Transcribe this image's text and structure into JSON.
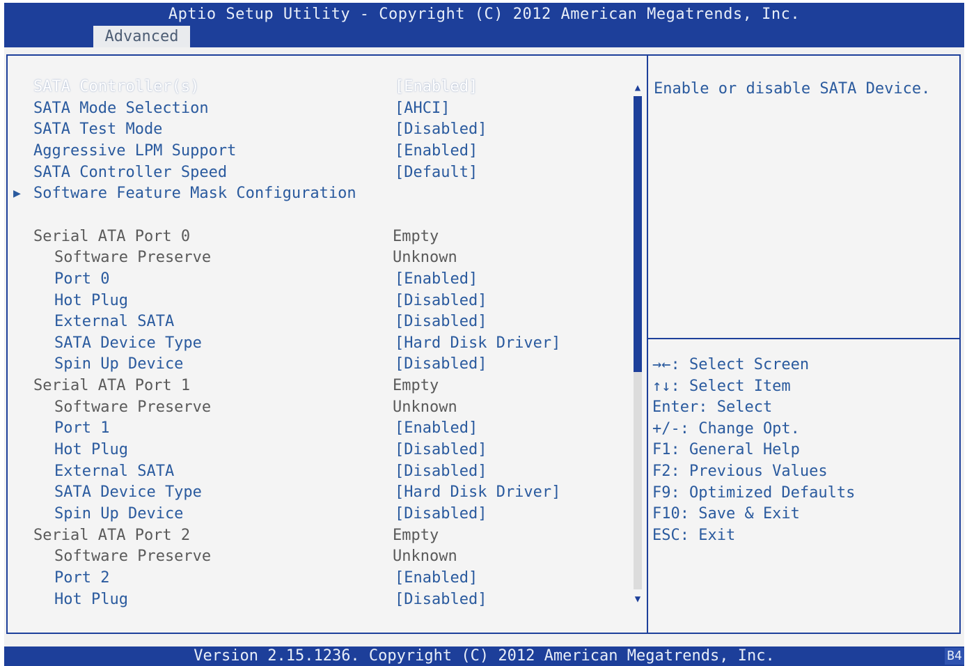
{
  "header": {
    "title": "Aptio Setup Utility - Copyright (C) 2012 American Megatrends, Inc.",
    "tab_label": "Advanced"
  },
  "settings": [
    {
      "label": "SATA Controller(s)",
      "value": "[Enabled]",
      "indent": 0,
      "style": "selected",
      "submenu": false
    },
    {
      "label": "SATA Mode Selection",
      "value": "[AHCI]",
      "indent": 0,
      "style": "blue",
      "submenu": false
    },
    {
      "label": "SATA Test Mode",
      "value": "[Disabled]",
      "indent": 0,
      "style": "blue",
      "submenu": false
    },
    {
      "label": "Aggressive LPM Support",
      "value": "[Enabled]",
      "indent": 0,
      "style": "blue",
      "submenu": false
    },
    {
      "label": "SATA Controller Speed",
      "value": "[Default]",
      "indent": 0,
      "style": "blue",
      "submenu": false
    },
    {
      "label": "Software Feature Mask Configuration",
      "value": "",
      "indent": 0,
      "style": "blue",
      "submenu": true
    },
    {
      "label": "",
      "value": "",
      "indent": 0,
      "style": "gray",
      "submenu": false
    },
    {
      "label": "Serial ATA Port 0",
      "value": "Empty",
      "indent": 0,
      "style": "gray",
      "submenu": false
    },
    {
      "label": "Software Preserve",
      "value": "Unknown",
      "indent": 1,
      "style": "gray",
      "submenu": false
    },
    {
      "label": "Port 0",
      "value": "[Enabled]",
      "indent": 1,
      "style": "blue",
      "submenu": false
    },
    {
      "label": "Hot Plug",
      "value": "[Disabled]",
      "indent": 1,
      "style": "blue",
      "submenu": false
    },
    {
      "label": "External SATA",
      "value": "[Disabled]",
      "indent": 1,
      "style": "blue",
      "submenu": false
    },
    {
      "label": "SATA Device Type",
      "value": "[Hard Disk Driver]",
      "indent": 1,
      "style": "blue",
      "submenu": false
    },
    {
      "label": "Spin Up Device",
      "value": "[Disabled]",
      "indent": 1,
      "style": "blue",
      "submenu": false
    },
    {
      "label": "Serial ATA Port 1",
      "value": "Empty",
      "indent": 0,
      "style": "gray",
      "submenu": false
    },
    {
      "label": "Software Preserve",
      "value": "Unknown",
      "indent": 1,
      "style": "gray",
      "submenu": false
    },
    {
      "label": "Port 1",
      "value": "[Enabled]",
      "indent": 1,
      "style": "blue",
      "submenu": false
    },
    {
      "label": "Hot Plug",
      "value": "[Disabled]",
      "indent": 1,
      "style": "blue",
      "submenu": false
    },
    {
      "label": "External SATA",
      "value": "[Disabled]",
      "indent": 1,
      "style": "blue",
      "submenu": false
    },
    {
      "label": "SATA Device Type",
      "value": "[Hard Disk Driver]",
      "indent": 1,
      "style": "blue",
      "submenu": false
    },
    {
      "label": "Spin Up Device",
      "value": "[Disabled]",
      "indent": 1,
      "style": "blue",
      "submenu": false
    },
    {
      "label": "Serial ATA Port 2",
      "value": "Empty",
      "indent": 0,
      "style": "gray",
      "submenu": false
    },
    {
      "label": "Software Preserve",
      "value": "Unknown",
      "indent": 1,
      "style": "gray",
      "submenu": false
    },
    {
      "label": "Port 2",
      "value": "[Enabled]",
      "indent": 1,
      "style": "blue",
      "submenu": false
    },
    {
      "label": "Hot Plug",
      "value": "[Disabled]",
      "indent": 1,
      "style": "blue",
      "submenu": false
    }
  ],
  "help": {
    "text": "Enable or disable SATA Device."
  },
  "keys": [
    "→←: Select Screen",
    "↑↓: Select Item",
    "Enter: Select",
    "+/-: Change Opt.",
    "F1: General Help",
    "F2: Previous Values",
    "F9: Optimized Defaults",
    "F10: Save & Exit",
    "ESC: Exit"
  ],
  "footer": {
    "text": "Version 2.15.1236. Copyright (C) 2012 American Megatrends, Inc.",
    "badge": "B4"
  },
  "scrollbar": {
    "up_glyph": "▲",
    "down_glyph": "▼"
  },
  "colors": {
    "bios_blue": "#1d3f9a",
    "text_blue": "#2a5a9e",
    "text_gray": "#5a5a5a",
    "background": "#f4f4f4"
  }
}
